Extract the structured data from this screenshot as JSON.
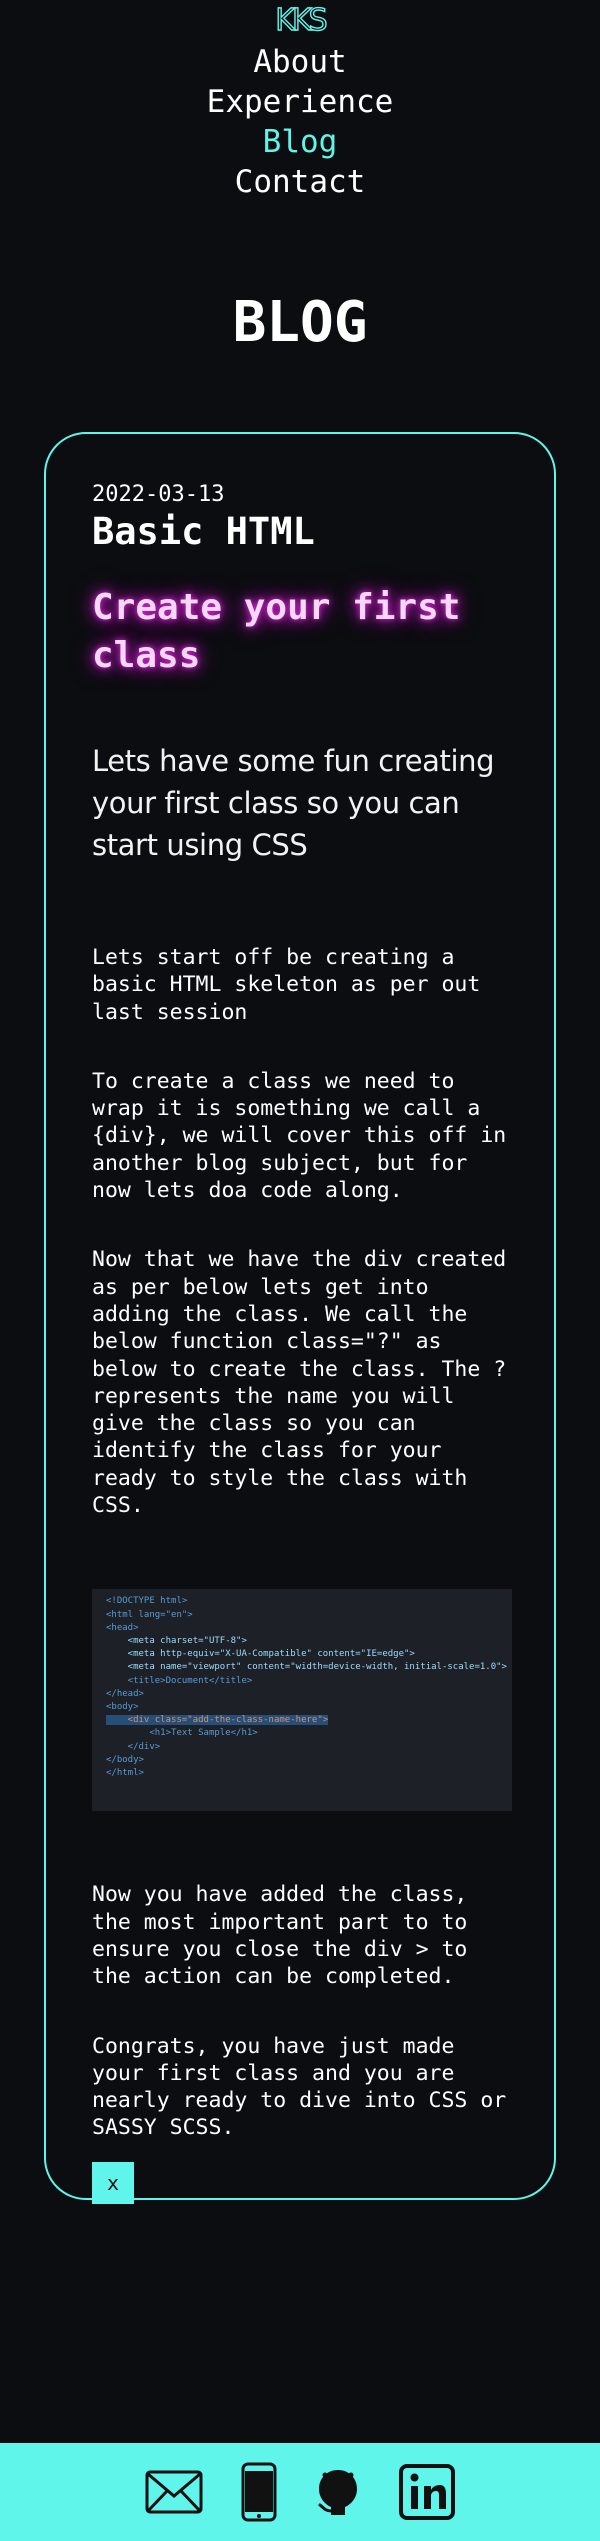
{
  "logo": {
    "text": "KKS"
  },
  "nav": {
    "items": [
      {
        "label": "About",
        "active": false
      },
      {
        "label": "Experience",
        "active": false
      },
      {
        "label": "Blog",
        "active": true
      },
      {
        "label": "Contact",
        "active": false
      }
    ]
  },
  "page": {
    "title": "BLOG"
  },
  "post": {
    "date": "2022-03-13",
    "title": "Basic HTML",
    "headline": "Create your first class",
    "lead": "Lets have some fun creating your first class so you can start using CSS",
    "paragraphs": [
      "Lets start off be creating a basic HTML skeleton as per out last session",
      "To create a class we need to wrap it is something we call a {div}, we will cover this off in another blog subject, but for now lets doa code along.",
      "Now that we have the div created as per below lets get into adding the class. We call the below function class=\"?\" as below to create the class. The ? represents the name you will give the class so you can identify the class for your ready to style the class with CSS.",
      "Now you have added the class, the most important part to to ensure you close the div > to the action can be completed.",
      "Congrats, you have just made your first class and you are nearly ready to dive into CSS or SASSY SCSS."
    ],
    "code_lines": [
      "<!DOCTYPE html>",
      "<html lang=\"en\">",
      "<head>",
      "    <meta charset=\"UTF-8\">",
      "    <meta http-equiv=\"X-UA-Compatible\" content=\"IE=edge\">",
      "    <meta name=\"viewport\" content=\"width=device-width, initial-scale=1.0\">",
      "    <title>Document</title>",
      "</head>",
      "<body>",
      "",
      "    <div class=\"add-the-class-name-here\">",
      "        <h1>Text Sample</h1>",
      "    </div>",
      "",
      "</body>",
      "</html>"
    ],
    "close_label": "x"
  },
  "footer": {
    "icons": [
      "mail-icon",
      "phone-icon",
      "github-icon",
      "linkedin-icon"
    ]
  },
  "colors": {
    "background": "#0b0d10",
    "accent": "#5ff5ea",
    "headline_glow": "#c018c0"
  }
}
